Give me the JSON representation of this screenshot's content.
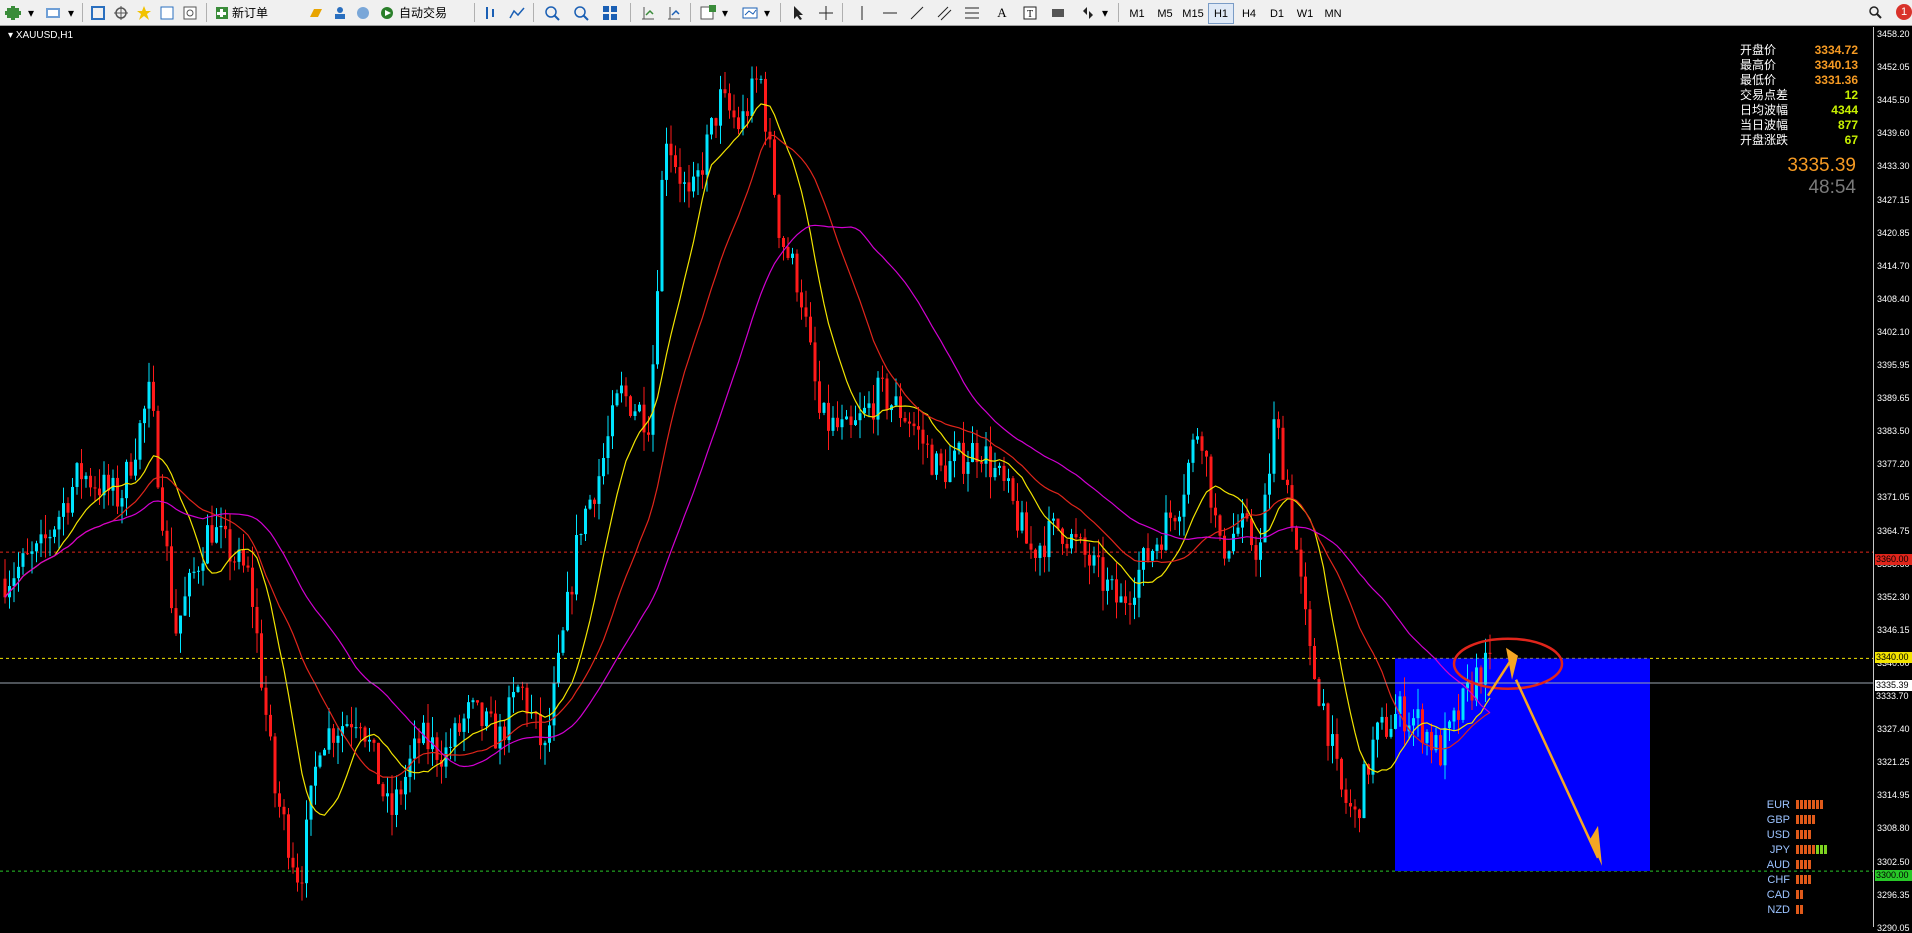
{
  "toolbar": {
    "buttons": [
      "new-chart",
      "profiles",
      "market-watch",
      "navigator",
      "data-window",
      "terminal",
      "tester"
    ],
    "new_order_label": "新订单",
    "auto_trade_label": "自动交易",
    "timeframes": [
      "M1",
      "M5",
      "M15",
      "H1",
      "H4",
      "D1",
      "W1",
      "MN"
    ],
    "active_timeframe": "H1",
    "alert_count": "1"
  },
  "chart": {
    "symbol_label": "XAUUSD,H1",
    "background": "#000000",
    "bull_color": "#00e5ff",
    "bear_color": "#ff1a1a",
    "price_scale": [
      "3458.20",
      "3452.05",
      "3445.50",
      "3439.60",
      "3433.30",
      "3427.15",
      "3420.85",
      "3414.70",
      "3408.40",
      "3402.10",
      "3395.95",
      "3389.65",
      "3383.50",
      "3377.20",
      "3371.05",
      "3364.75",
      "3358.60",
      "3352.30",
      "3346.15",
      "3340.00",
      "3333.70",
      "3327.40",
      "3321.25",
      "3314.95",
      "3308.80",
      "3302.50",
      "3296.35",
      "3290.05"
    ],
    "level_labels": {
      "red_line": "3360.00",
      "yellow_line": "3340.00",
      "bid_line": "3335.39",
      "green_line": "3300.00",
      "bid_line_low": "3333.70"
    },
    "info": {
      "open_label": "开盘价",
      "open_value": "3334.72",
      "high_label": "最高价",
      "high_value": "3340.13",
      "low_label": "最低价",
      "low_value": "3331.36",
      "spread_label": "交易点差",
      "spread_value": "12",
      "avg_range_label": "日均波幅",
      "avg_range_value": "4344",
      "day_range_label": "当日波幅",
      "day_range_value": "877",
      "open_change_label": "开盘涨跌",
      "open_change_value": "67"
    },
    "current_price": "3335.39",
    "bar_timer": "48:54",
    "strength": [
      {
        "name": "EUR",
        "level": 7,
        "color": "#e05a1a"
      },
      {
        "name": "GBP",
        "level": 5,
        "color": "#e05a1a"
      },
      {
        "name": "USD",
        "level": 4,
        "color": "#e05a1a"
      },
      {
        "name": "JPY",
        "level": 8,
        "color": "#e05a1a"
      },
      {
        "name": "AUD",
        "level": 4,
        "color": "#e05a1a"
      },
      {
        "name": "CHF",
        "level": 4,
        "color": "#e05a1a"
      },
      {
        "name": "CAD",
        "level": 2,
        "color": "#e05a1a"
      },
      {
        "name": "NZD",
        "level": 2,
        "color": "#e05a1a"
      }
    ]
  }
}
